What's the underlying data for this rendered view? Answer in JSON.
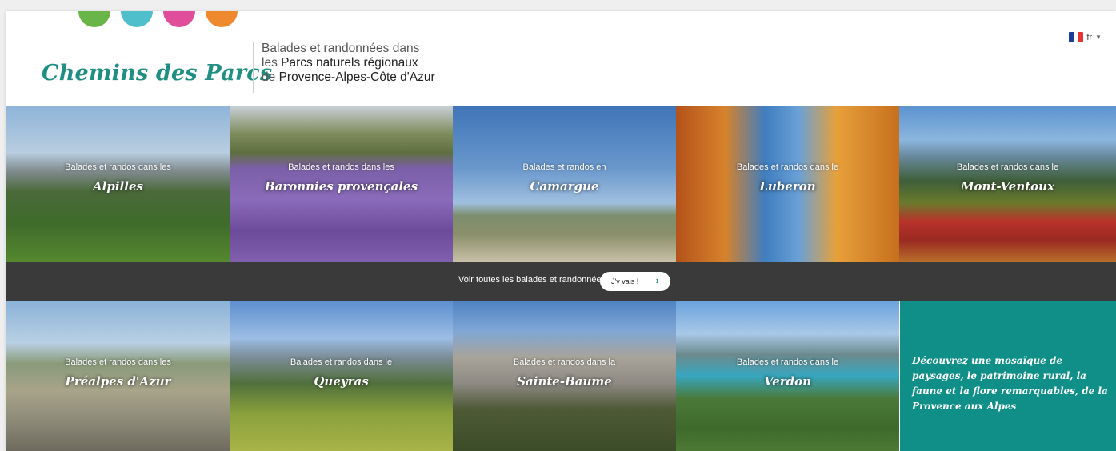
{
  "header": {
    "logo": "Chemins des Parcs",
    "tagline_line1": "Balades et randonnées dans",
    "tagline_line2_prefix": "les ",
    "tagline_line2_strong": "Parcs naturels régionaux",
    "tagline_line3_prefix": "de ",
    "tagline_line3_strong": "Provence-Alpes-Côte d'Azur",
    "dot_colors": [
      "#6ab547",
      "#4fbfcb",
      "#e04d9a",
      "#ee8a2d"
    ]
  },
  "language": {
    "code": "fr",
    "flag_colors": [
      "#1a3d99",
      "#ffffff",
      "#e63333"
    ]
  },
  "parks_row1": [
    {
      "pre": "Balades et randos dans les",
      "name": "Alpilles"
    },
    {
      "pre": "Balades et randos dans les",
      "name": "Baronnies provençales"
    },
    {
      "pre": "Balades et randos en",
      "name": "Camargue"
    },
    {
      "pre": "Balades et randos dans le",
      "name": "Luberon"
    },
    {
      "pre": "Balades et randos dans le",
      "name": "Mont-Ventoux"
    }
  ],
  "band": {
    "text": "Voir toutes les balades et randonnées",
    "button": "J'y vais !"
  },
  "parks_row2": [
    {
      "pre": "Balades et randos dans les",
      "name": "Préalpes d'Azur"
    },
    {
      "pre": "Balades et randos dans le",
      "name": "Queyras"
    },
    {
      "pre": "Balades et randos dans la",
      "name": "Sainte-Baume"
    },
    {
      "pre": "Balades et randos dans le",
      "name": "Verdon"
    }
  ],
  "promo": {
    "text": "Découvrez une mosaïque de paysages, le patrimoine rural, la faune et la flore remarquables, de la Provence aux Alpes"
  },
  "colors": {
    "brand": "#1f8f84",
    "band": "#3a3a3a",
    "promo": "#0f8f88"
  }
}
